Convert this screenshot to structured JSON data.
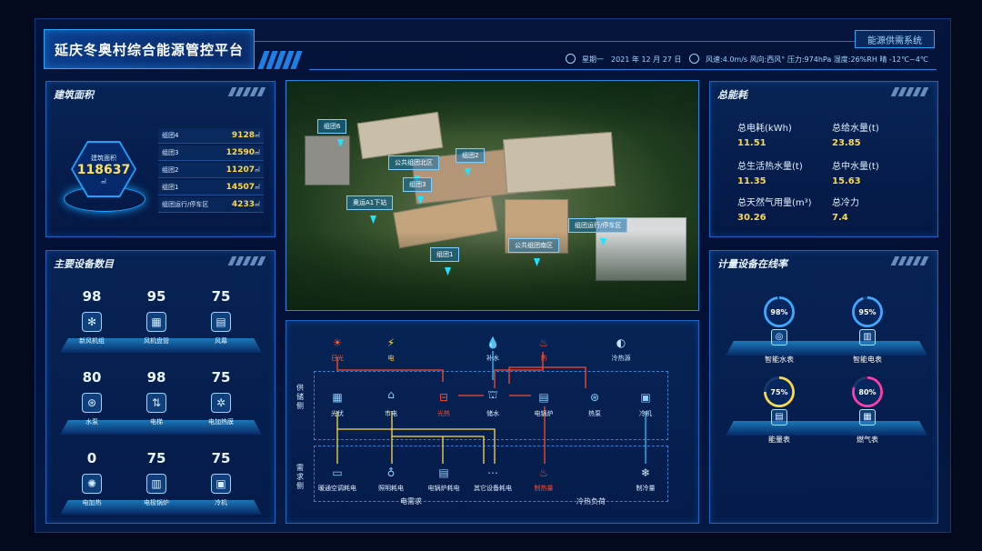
{
  "header": {
    "title": "延庆冬奥村综合能源管控平台",
    "system_button": "能源供需系统",
    "date": "星期一　2021 年 12 月 27 日",
    "weather": "风速:4.0m/s 风向:西风° 压力:974hPa 湿度:26%RH 晴 -12℃~4℃"
  },
  "building_area": {
    "title": "建筑面积",
    "total_label": "建筑面积",
    "total_value": "118637",
    "unit": "㎡",
    "rows": [
      {
        "name": "组团4",
        "value": "9128"
      },
      {
        "name": "组团3",
        "value": "12590"
      },
      {
        "name": "组团2",
        "value": "11207"
      },
      {
        "name": "组团1",
        "value": "14507"
      },
      {
        "name": "组团运行/停车区",
        "value": "4233"
      }
    ]
  },
  "devices": {
    "title": "主要设备数目",
    "items": [
      {
        "value": "98",
        "label": "新风机组",
        "icon": "fan-icon"
      },
      {
        "value": "95",
        "label": "风机盘管",
        "icon": "coil-icon"
      },
      {
        "value": "75",
        "label": "风幕",
        "icon": "curtain-icon"
      },
      {
        "value": "80",
        "label": "水泵",
        "icon": "pump-icon"
      },
      {
        "value": "98",
        "label": "电梯",
        "icon": "elevator-icon"
      },
      {
        "value": "75",
        "label": "电加热膜",
        "icon": "heat-film-icon"
      },
      {
        "value": "0",
        "label": "电加热",
        "icon": "heater-icon"
      },
      {
        "value": "75",
        "label": "电极锅炉",
        "icon": "boiler-icon"
      },
      {
        "value": "75",
        "label": "冷机",
        "icon": "chiller-icon"
      }
    ]
  },
  "map": {
    "labels": [
      "组团6",
      "公共组团北区",
      "组团2",
      "组团3",
      "奥运A1下站",
      "组团运行/停车区",
      "公共组团南区",
      "组团1"
    ]
  },
  "flow": {
    "side_supply": "供储侧",
    "side_demand": "需求侧",
    "sources": [
      "日光",
      "电",
      "补水",
      "热",
      "冷热源"
    ],
    "supply_nodes": [
      "光伏",
      "市电",
      "光热",
      "储水",
      "电锅炉",
      "热泵",
      "冷机"
    ],
    "demand_nodes": [
      "暖通空调耗电",
      "照明耗电",
      "电锅炉耗电",
      "其它设备耗电",
      "制热量",
      "制冷量"
    ],
    "group_labels": [
      "电需求",
      "冷热负荷"
    ]
  },
  "totals": {
    "title": "总能耗",
    "items": [
      {
        "label": "总电耗(kWh)",
        "value": "11.51"
      },
      {
        "label": "总给水量(t)",
        "value": "23.85"
      },
      {
        "label": "总生活热水量(t)",
        "value": "11.35"
      },
      {
        "label": "总中水量(t)",
        "value": "15.63"
      },
      {
        "label": "总天然气用量(m³)",
        "value": "30.26"
      },
      {
        "label": "总冷力",
        "value": "7.4"
      }
    ]
  },
  "meters": {
    "title": "计量设备在线率",
    "items": [
      {
        "pct": "98%",
        "label": "智能水表",
        "color": "#3fa9ff",
        "fraction": 0.98
      },
      {
        "pct": "95%",
        "label": "智能电表",
        "color": "#3fa9ff",
        "fraction": 0.95
      },
      {
        "pct": "75%",
        "label": "能量表",
        "color": "#ffd84a",
        "fraction": 0.75
      },
      {
        "pct": "80%",
        "label": "燃气表",
        "color": "#ff3fa8",
        "fraction": 0.8
      }
    ]
  },
  "colors": {
    "accent": "#2aa6ff",
    "value_yellow": "#ffd84a",
    "heat_red": "#ff4a2a"
  }
}
